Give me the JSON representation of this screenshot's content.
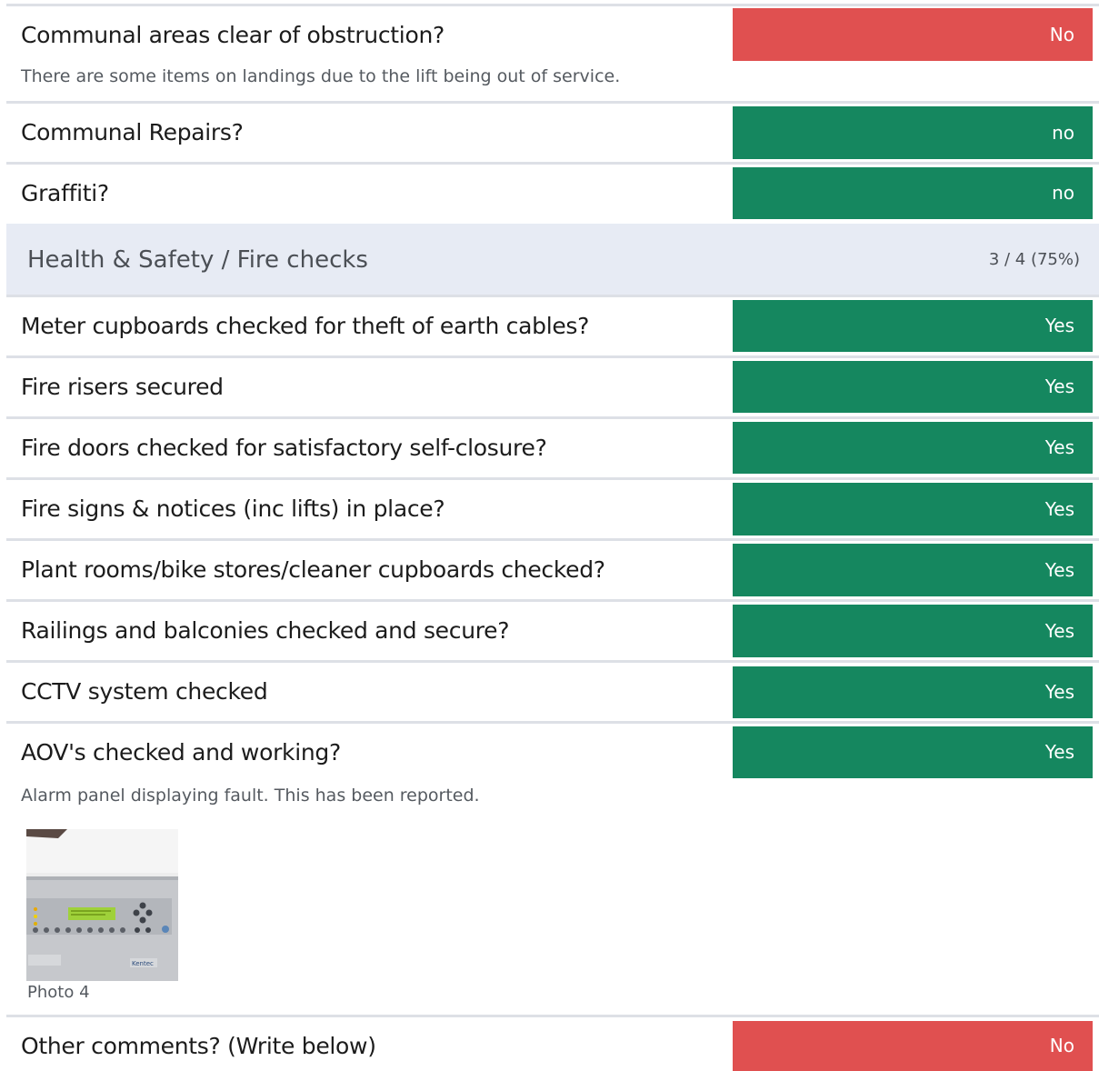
{
  "rows": [
    {
      "question": "Communal areas clear of obstruction?",
      "answer": "No",
      "note": "There are some items on landings due to the lift being out of service."
    },
    {
      "question": "Communal Repairs?",
      "answer": "no"
    },
    {
      "question": "Graffiti?",
      "answer": "no"
    }
  ],
  "section": {
    "title": "Health & Safety / Fire checks",
    "score": "3 / 4 (75%)"
  },
  "checks": [
    {
      "question": "Meter cupboards checked for theft of earth cables?",
      "answer": "Yes"
    },
    {
      "question": "Fire risers secured",
      "answer": "Yes"
    },
    {
      "question": "Fire doors checked for satisfactory self-closure?",
      "answer": "Yes"
    },
    {
      "question": "Fire signs & notices (inc lifts) in place?",
      "answer": "Yes"
    },
    {
      "question": "Plant rooms/bike stores/cleaner cupboards checked?",
      "answer": "Yes"
    },
    {
      "question": "Railings and balconies checked and secure?",
      "answer": "Yes"
    },
    {
      "question": "CCTV system checked",
      "answer": "Yes"
    },
    {
      "question": "AOV's checked and working?",
      "answer": "Yes",
      "note": "Alarm panel displaying fault. This has been reported.",
      "photo_caption": "Photo 4"
    }
  ],
  "last": {
    "question": "Other comments? (Write below)",
    "answer": "No"
  },
  "colors": {
    "yes": "#15875f",
    "no": "#e05050",
    "section_bg": "#e7ebf4"
  },
  "photo": {
    "brand_text": "Kentec",
    "icon": "fire-alarm-panel-photo"
  }
}
